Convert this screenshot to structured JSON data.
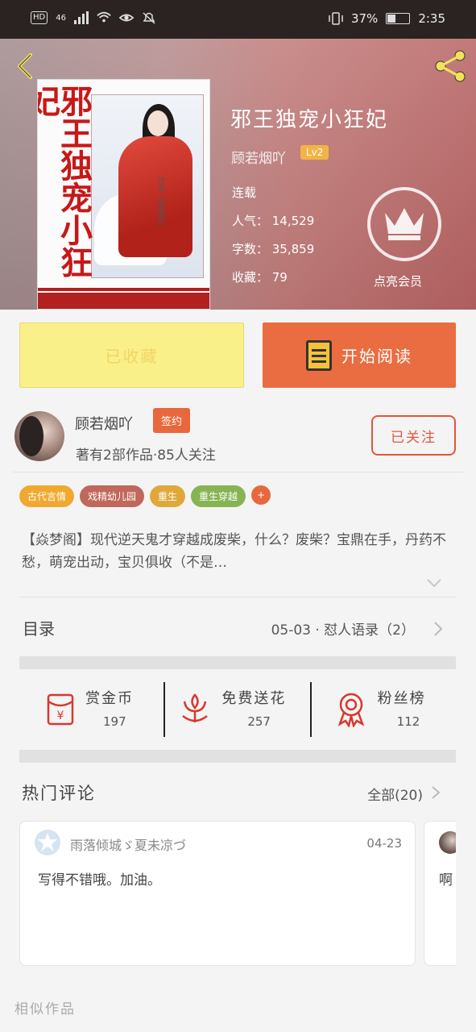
{
  "status_bar": {
    "hd": "HD",
    "network": "46",
    "battery": "37%",
    "time": "2:35"
  },
  "book": {
    "title": "邪王独宠小狂妃",
    "cover_title": "邪王独宠小狂妃",
    "cover_author": "作者：顾若烟吖",
    "author": "顾若烟吖",
    "level": "Lv2",
    "status": "连载",
    "popularity": "人气： 14,529",
    "word_count": "字数： 35,859",
    "favorites": "收藏： 79"
  },
  "vip": {
    "label": "点亮会员"
  },
  "actions": {
    "favorited_label": "已收藏",
    "read_label": "开始阅读"
  },
  "author_info": {
    "name": "顾若烟吖",
    "badge": "签约",
    "works": "著有2部作品·85人关注",
    "follow_label": "已关注"
  },
  "tags": [
    {
      "label": "古代言情",
      "color": "#f0a930"
    },
    {
      "label": "戏精幼儿园",
      "color": "#c0685a"
    },
    {
      "label": "重生",
      "color": "#e0a83a"
    },
    {
      "label": "重生穿越",
      "color": "#86b453"
    }
  ],
  "tag_more": "+",
  "description": "【焱梦阁】现代逆天鬼才穿越成废柴，什么？废柴？宝鼎在手，丹药不愁，萌宠出动，宝贝俱收（不是…",
  "toc": {
    "label": "目录",
    "latest": "05-03 · 怼人语录（2）"
  },
  "stats": [
    {
      "name": "赏金币",
      "value": "197",
      "icon": "red-envelope-icon"
    },
    {
      "name": "免费送花",
      "value": "257",
      "icon": "flower-icon"
    },
    {
      "name": "粉丝榜",
      "value": "112",
      "icon": "medal-icon"
    }
  ],
  "comments": {
    "title": "热门评论",
    "all_label": "全部(20)",
    "items": [
      {
        "user": "雨落倾城ゞ夏未凉づ",
        "date": "04-23",
        "text": "写得不错哦。加油。"
      },
      {
        "user": "",
        "date": "",
        "text": "啊"
      }
    ]
  },
  "similar_label": "相似作品",
  "colors": {
    "accent_orange": "#ea6d41",
    "favorite_yellow": "#faf08a",
    "follow_red": "#e2563b"
  }
}
